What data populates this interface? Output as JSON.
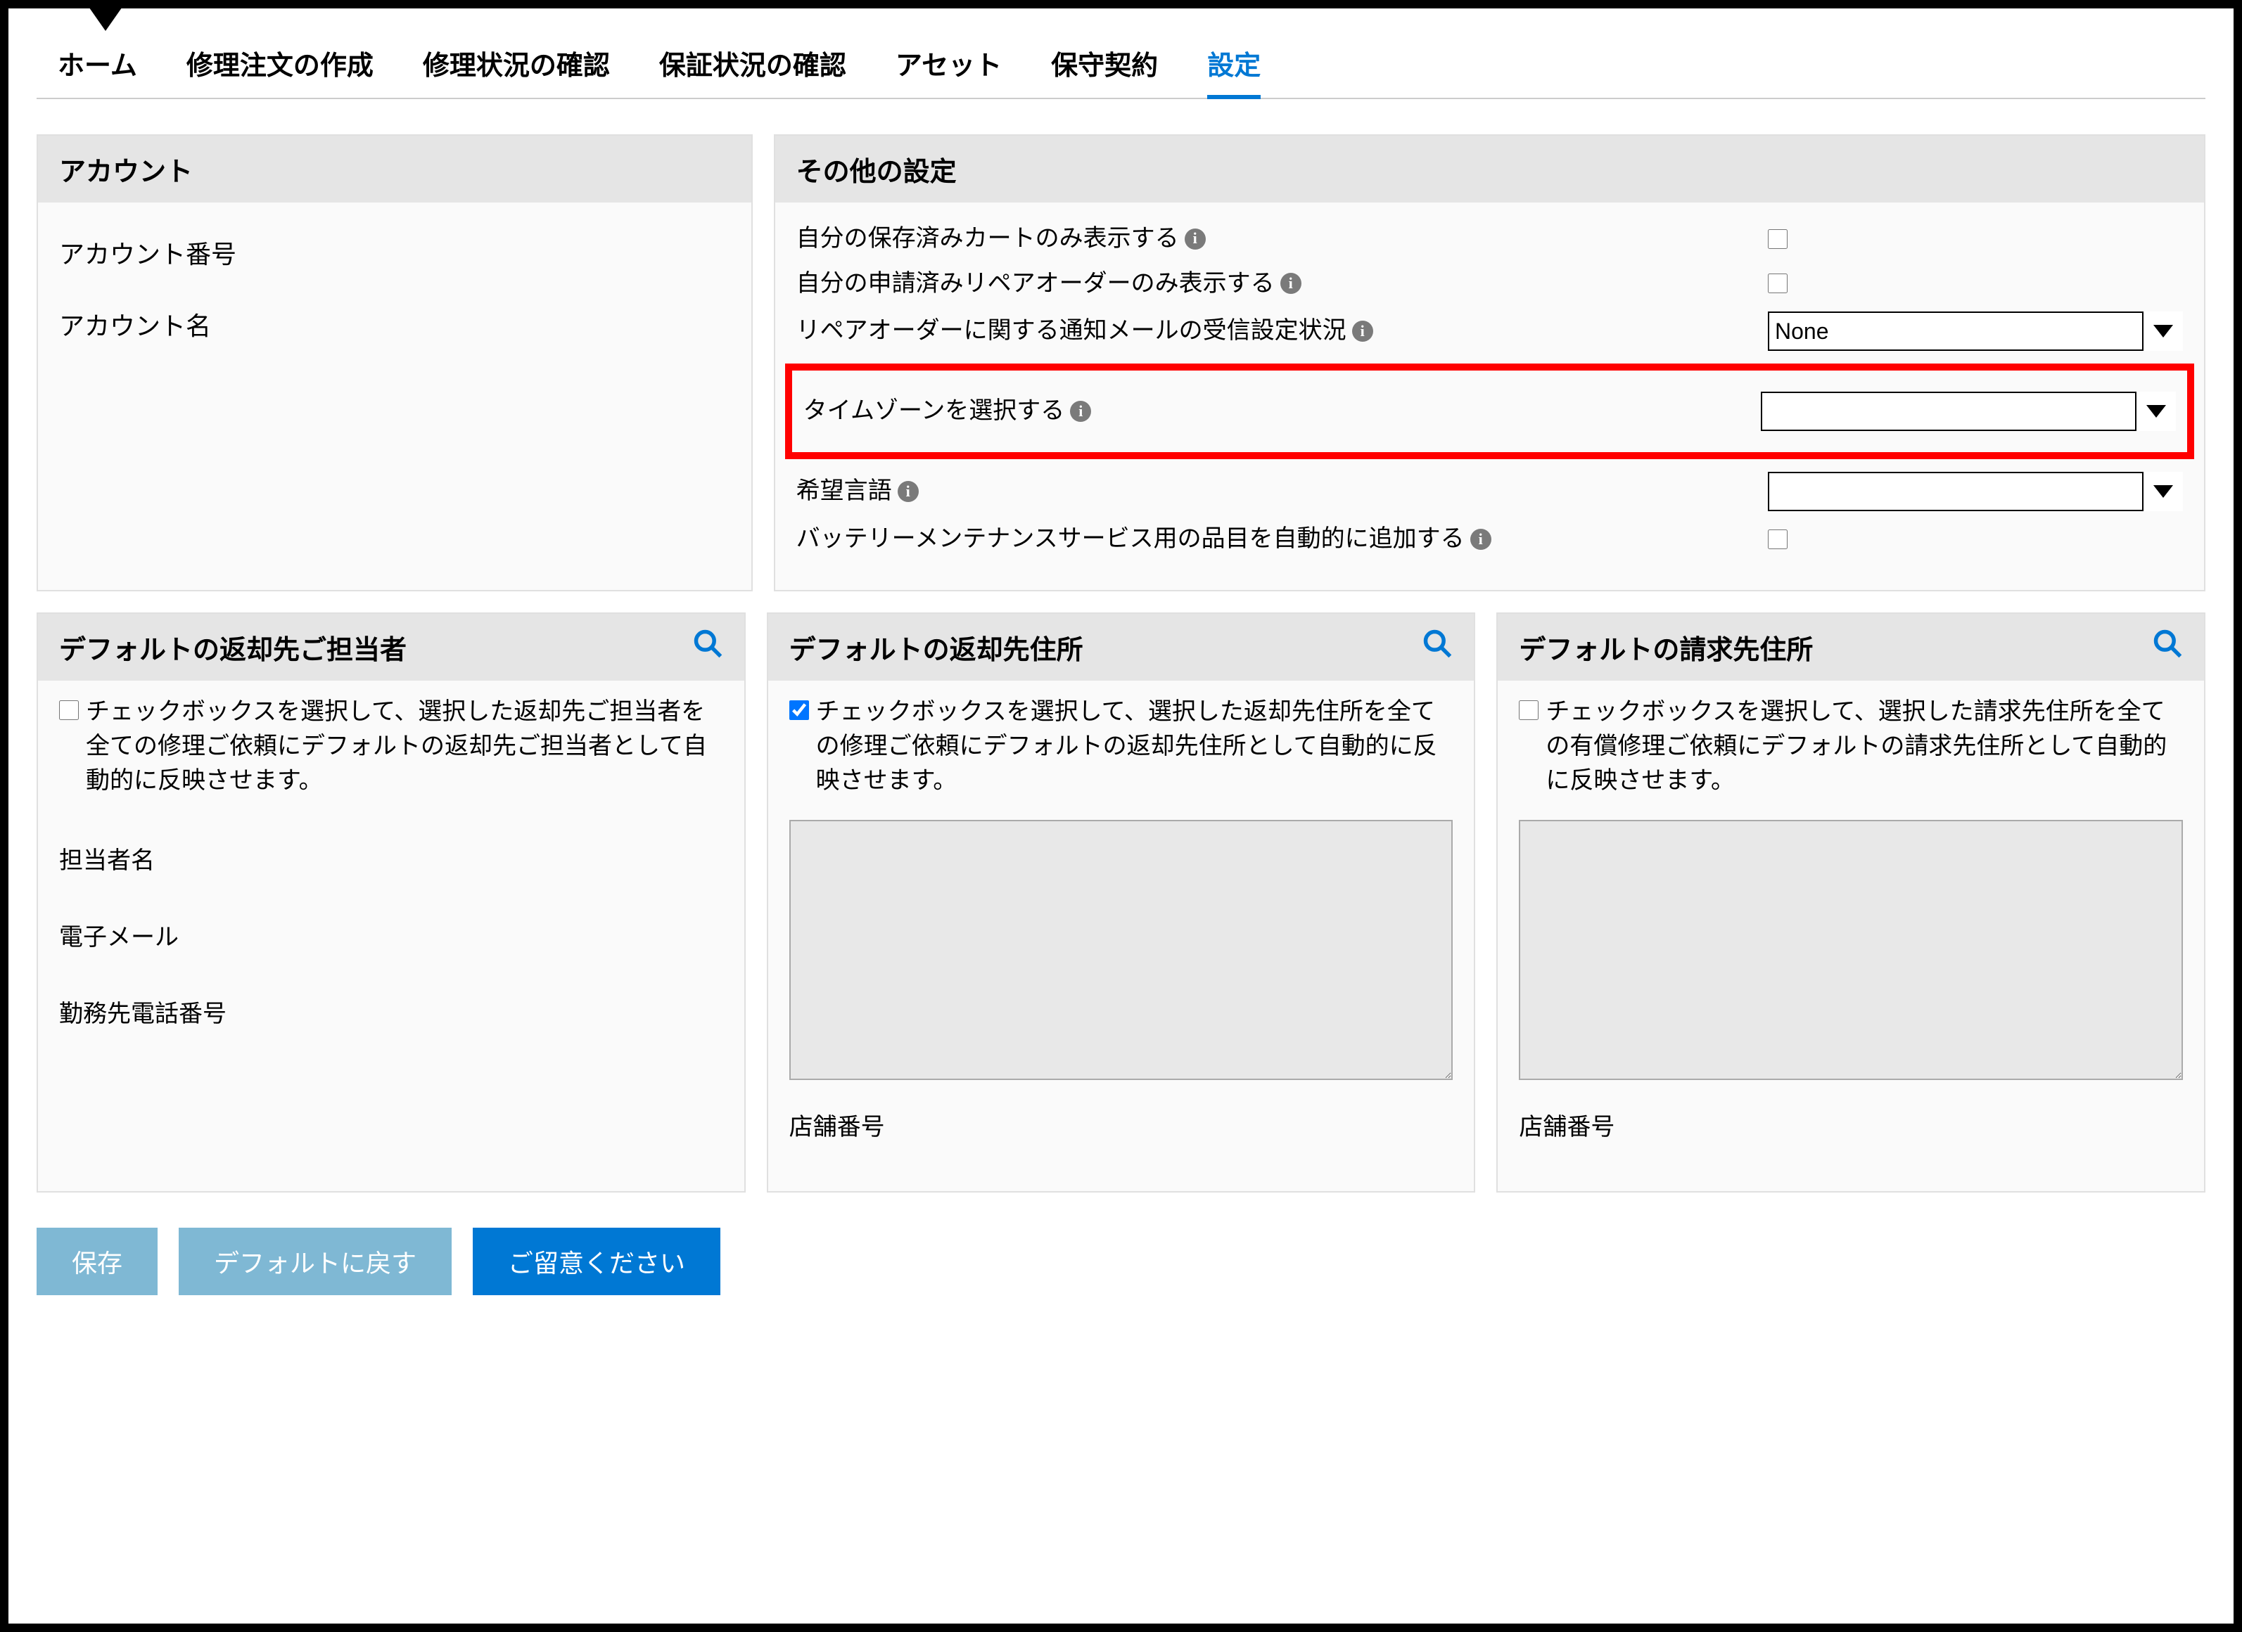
{
  "tabs": {
    "home": "ホーム",
    "create": "修理注文の作成",
    "status": "修理状況の確認",
    "warranty": "保証状況の確認",
    "asset": "アセット",
    "contract": "保守契約",
    "settings": "設定"
  },
  "account": {
    "header": "アカウント",
    "number_label": "アカウント番号",
    "name_label": "アカウント名"
  },
  "other": {
    "header": "その他の設定",
    "saved_cart": "自分の保存済みカートのみ表示する",
    "repair_order": "自分の申請済みリペアオーダーのみ表示する",
    "notify": "リペアオーダーに関する通知メールの受信設定状況",
    "notify_value": "None",
    "timezone": "タイムゾーンを選択する",
    "timezone_value": "",
    "lang": "希望言語",
    "lang_value": "",
    "battery": "バッテリーメンテナンスサービス用の品目を自動的に追加する"
  },
  "contact": {
    "header": "デフォルトの返却先ご担当者",
    "cb_text": "チェックボックスを選択して、選択した返却先ご担当者を全ての修理ご依頼にデフォルトの返却先ご担当者として自動的に反映させます。",
    "name": "担当者名",
    "email": "電子メール",
    "phone": "勤務先電話番号"
  },
  "return_addr": {
    "header": "デフォルトの返却先住所",
    "cb_text": "チェックボックスを選択して、選択した返却先住所を全ての修理ご依頼にデフォルトの返却先住所として自動的に反映させます。",
    "store": "店舗番号"
  },
  "bill_addr": {
    "header": "デフォルトの請求先住所",
    "cb_text": "チェックボックスを選択して、選択した請求先住所を全ての有償修理ご依頼にデフォルトの請求先住所として自動的に反映させます。",
    "store": "店舗番号"
  },
  "buttons": {
    "save": "保存",
    "reset": "デフォルトに戻す",
    "note": "ご留意ください"
  }
}
